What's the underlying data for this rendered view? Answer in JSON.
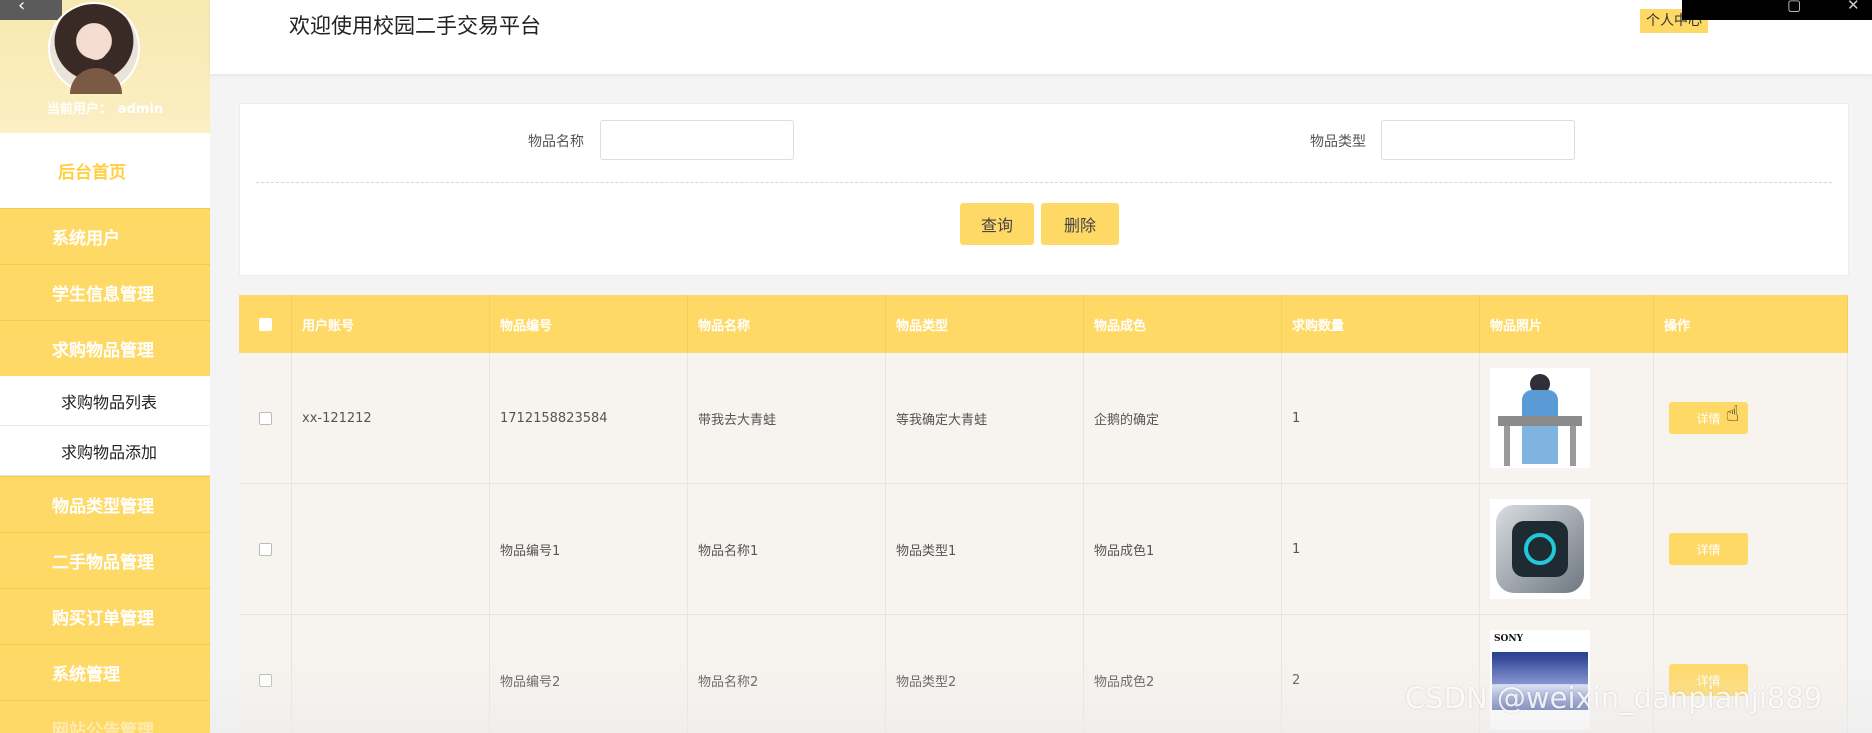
{
  "header": {
    "site_title": "欢迎使用校园二手交易平台",
    "personal_center": "个人中心"
  },
  "sidebar": {
    "current_user_label": "当前用户：",
    "current_user": "admin",
    "home": "后台首页",
    "items": [
      {
        "label": "系统用户"
      },
      {
        "label": "学生信息管理"
      },
      {
        "label": "求购物品管理"
      }
    ],
    "sub_items": [
      {
        "label": "求购物品列表"
      },
      {
        "label": "求购物品添加"
      }
    ],
    "items_after": [
      {
        "label": "物品类型管理"
      },
      {
        "label": "二手物品管理"
      },
      {
        "label": "购买订单管理"
      },
      {
        "label": "系统管理"
      },
      {
        "label": "网站公告管理"
      }
    ]
  },
  "search": {
    "name_label": "物品名称",
    "type_label": "物品类型",
    "query_button": "查询",
    "delete_button": "删除"
  },
  "table": {
    "columns": [
      "用户账号",
      "物品编号",
      "物品名称",
      "物品类型",
      "物品成色",
      "求购数量",
      "物品照片",
      "操作"
    ],
    "detail_label": "详情",
    "rows": [
      {
        "account": "xx-121212",
        "code": "1712158823584",
        "name": "带我去大青蛙",
        "type": "等我确定大青蛙",
        "condition": "企鹅的确定",
        "qty": "1",
        "photo": "student-image"
      },
      {
        "account": "",
        "code": "物品编号1",
        "name": "物品名称1",
        "type": "物品类型1",
        "condition": "物品成色1",
        "qty": "1",
        "photo": "pc-image"
      },
      {
        "account": "",
        "code": "物品编号2",
        "name": "物品名称2",
        "type": "物品类型2",
        "condition": "物品成色2",
        "qty": "2",
        "photo": "tv-image",
        "photo_brand": "SONY"
      }
    ]
  },
  "watermark": "CSDN @weixin_danpianji889",
  "colors": {
    "accent": "#ffd966",
    "home_text": "#ffcf40",
    "row_bg": "#f7f3ef"
  }
}
